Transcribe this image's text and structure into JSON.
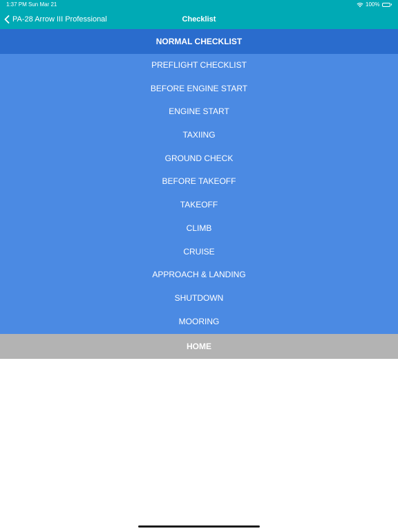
{
  "status_bar": {
    "time": "1:37 PM",
    "date": "Sun Mar 21",
    "battery": "100%"
  },
  "nav": {
    "back_label": "PA-28 Arrow III Professional",
    "title": "Checklist"
  },
  "section_header": "NORMAL CHECKLIST",
  "items": [
    {
      "label": "PREFLIGHT CHECKLIST"
    },
    {
      "label": "BEFORE ENGINE START"
    },
    {
      "label": "ENGINE START"
    },
    {
      "label": "TAXIING"
    },
    {
      "label": "GROUND CHECK"
    },
    {
      "label": "BEFORE TAKEOFF"
    },
    {
      "label": "TAKEOFF"
    },
    {
      "label": "CLIMB"
    },
    {
      "label": "CRUISE"
    },
    {
      "label": "APPROACH & LANDING"
    },
    {
      "label": "SHUTDOWN"
    },
    {
      "label": "MOORING"
    }
  ],
  "home_label": "HOME",
  "colors": {
    "nav_bar": "#00aab5",
    "section_header": "#2a6ccd",
    "list_background": "#4b8ae3",
    "home_background": "#b3b3b3"
  },
  "icons": {
    "back": "chevron-left-icon",
    "wifi": "wifi-icon",
    "battery": "battery-icon"
  }
}
